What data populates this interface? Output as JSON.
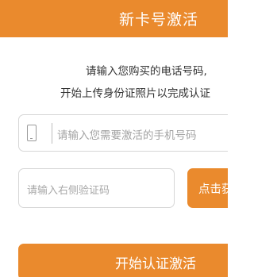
{
  "header": {
    "title": "新卡号激活"
  },
  "instructions": {
    "line1": "请输入您购买的电话号码,",
    "line2": "开始上传身份证照片以完成认证"
  },
  "phone_field": {
    "icon": "mobile-phone-icon",
    "placeholder": "请输入您需要激活的手机号码"
  },
  "code_field": {
    "placeholder": "请输入右侧验证码"
  },
  "get_code_button": {
    "label": "点击获取"
  },
  "start_button": {
    "label": "开始认证激活"
  },
  "colors": {
    "accent": "#ea8a2d",
    "field_border": "#d6d6d6",
    "placeholder": "#a3a3a3",
    "text": "#333333"
  }
}
